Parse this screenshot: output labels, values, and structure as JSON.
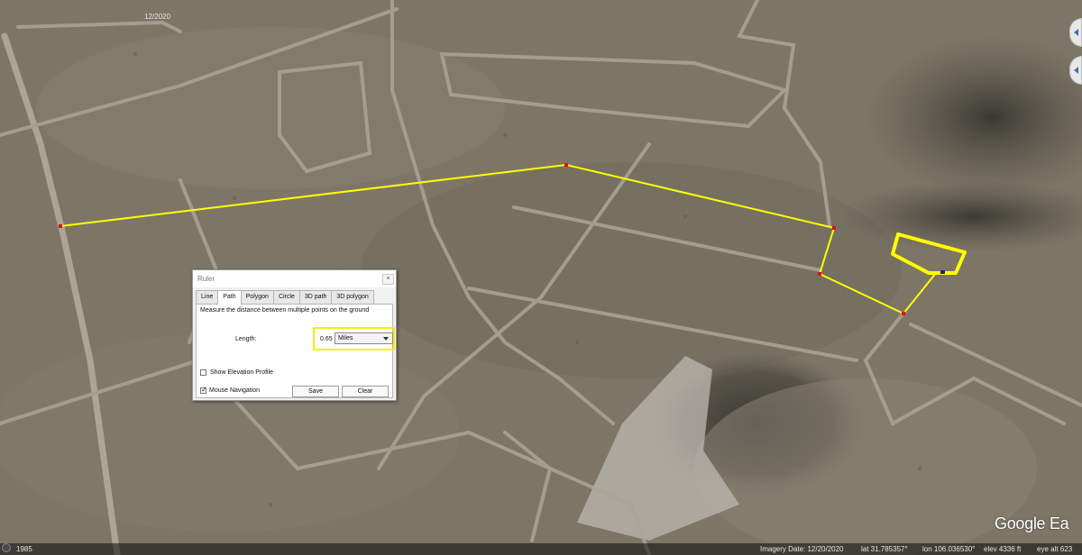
{
  "map": {
    "top_date_label": "12/2020",
    "logo": "Google Ea",
    "colors": {
      "path": "#ffff00",
      "vertex": "#e0101a",
      "terrain": "#7d7666"
    }
  },
  "ruler": {
    "title": "Ruler",
    "close_label": "×",
    "tabs": [
      "Line",
      "Path",
      "Polygon",
      "Circle",
      "3D path",
      "3D polygon"
    ],
    "active_tab": "Path",
    "description": "Measure the distance between multiple points on the ground",
    "length_label": "Length:",
    "length_value": "0.65",
    "unit_selected": "Miles",
    "show_elevation_label": "Show Elevation Profile",
    "show_elevation_checked": false,
    "mouse_nav_label": "Mouse Navigation",
    "mouse_nav_checked": true,
    "save_label": "Save",
    "clear_label": "Clear"
  },
  "status_bar": {
    "year": "1985",
    "imagery_date": "Imagery Date: 12/20/2020",
    "lat": "lat   31.785357°",
    "lon": "lon  106.036530°",
    "elev": "elev  4336 ft",
    "eye_alt": "eye alt   623"
  }
}
